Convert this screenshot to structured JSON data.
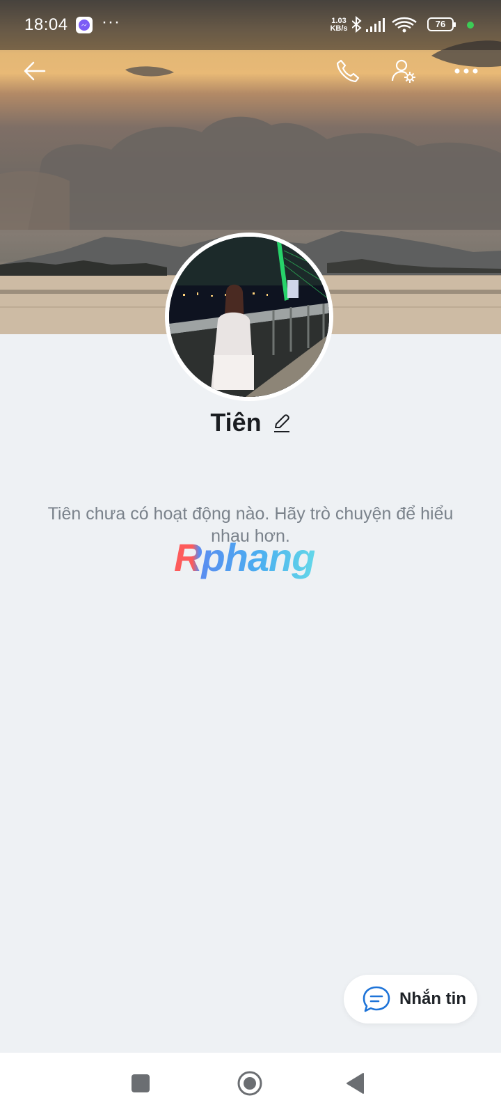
{
  "status_bar": {
    "time": "18:04",
    "more_indicator": "···",
    "net_speed_value": "1.03",
    "net_speed_unit": "KB/s",
    "battery": "76",
    "accent_green": "#3ccc56"
  },
  "header": {
    "back_icon": "arrow-left-icon",
    "call_icon": "phone-icon",
    "settings_icon": "user-settings-icon",
    "more_icon": "more-dots-icon"
  },
  "profile": {
    "name": "Tiên",
    "edit_icon": "pencil-icon",
    "empty_message": "Tiên chưa có hoạt động nào. Hãy trò chuyện để hiểu nhau hơn."
  },
  "watermark": "Rphang",
  "message_button": {
    "label": "Nhắn tin",
    "icon": "chat-bubble-icon",
    "accent": "#1d73d8"
  },
  "nav_bar": {
    "recents_icon": "square-icon",
    "home_icon": "circle-home-icon",
    "back_icon": "triangle-back-icon"
  }
}
